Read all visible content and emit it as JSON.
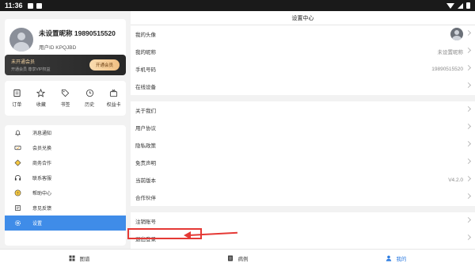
{
  "status_bar": {
    "time": "11:36"
  },
  "profile": {
    "nickname": "未设置昵称 19890515520",
    "user_id": "用户ID KPQJBD"
  },
  "vip": {
    "title": "未开通会员",
    "subtitle": "开通会员 尊享VIP权益",
    "button": "开通会员"
  },
  "quick_actions": [
    {
      "label": "订单",
      "icon": "order-icon"
    },
    {
      "label": "收藏",
      "icon": "star-icon"
    },
    {
      "label": "书签",
      "icon": "tag-icon"
    },
    {
      "label": "历史",
      "icon": "clock-icon"
    },
    {
      "label": "权益卡",
      "icon": "card-icon"
    }
  ],
  "menu": [
    {
      "label": "消息通知",
      "icon": "bell-icon"
    },
    {
      "label": "会员兑换",
      "icon": "ticket-icon"
    },
    {
      "label": "商务合作",
      "icon": "diamond-icon"
    },
    {
      "label": "联系客服",
      "icon": "headset-icon"
    },
    {
      "label": "帮助中心",
      "icon": "help-icon"
    },
    {
      "label": "意见反馈",
      "icon": "feedback-icon"
    },
    {
      "label": "设置",
      "icon": "gear-icon",
      "active": true
    }
  ],
  "settings": {
    "title": "设置中心",
    "avatar_label": "我的头像",
    "nickname_label": "我的昵称",
    "nickname_value": "未设置昵称",
    "phone_label": "手机号码",
    "phone_value": "19890515520",
    "device_label": "在线设备",
    "about_label": "关于我们",
    "agreement_label": "用户协议",
    "privacy_label": "隐私政策",
    "disclaimer_label": "免责声明",
    "version_label": "当前版本",
    "version_value": "V4.2.0",
    "partners_label": "合作伙伴",
    "cancel_label": "注销账号",
    "logout_label": "退出登录"
  },
  "bottom_nav": [
    {
      "label": "图谱",
      "icon": "grid-icon"
    },
    {
      "label": "病例",
      "icon": "document-icon"
    },
    {
      "label": "我的",
      "icon": "person-icon",
      "active": true
    }
  ],
  "colors": {
    "accent": "#3f8ce8",
    "annotation": "#e53935"
  }
}
